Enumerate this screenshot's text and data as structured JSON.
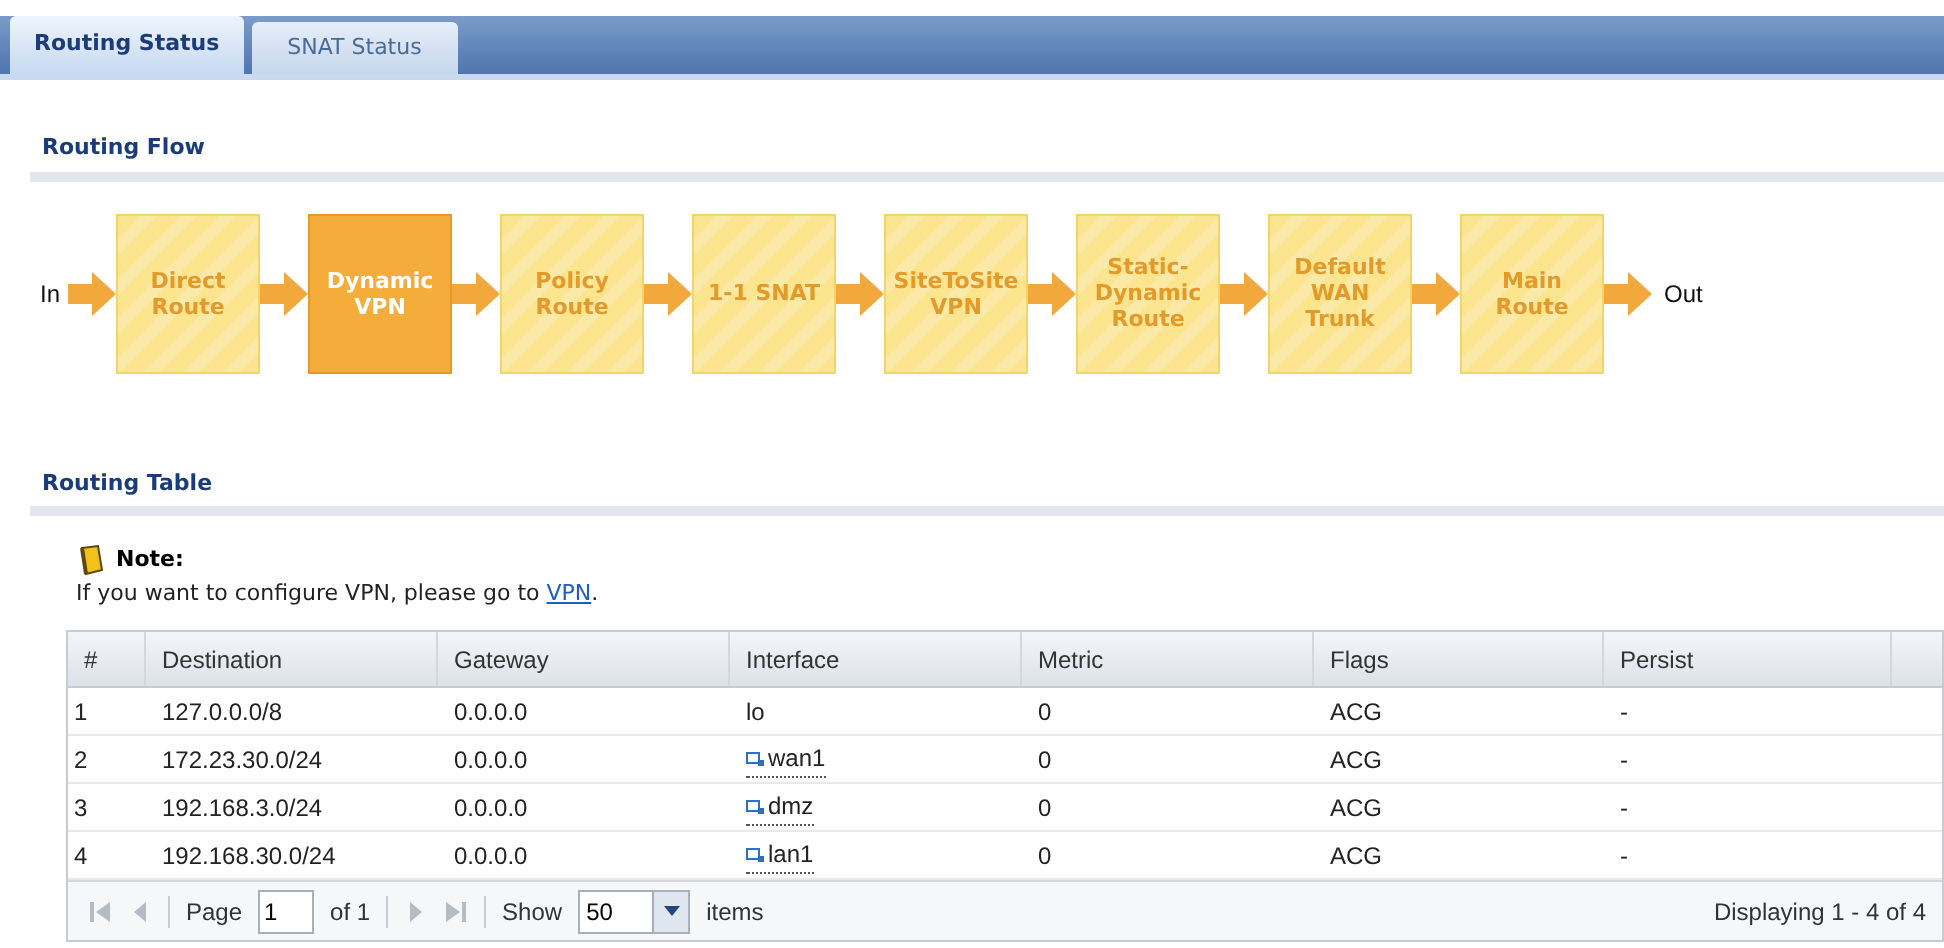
{
  "tabs": [
    {
      "label": "Routing Status",
      "selected": true
    },
    {
      "label": "SNAT Status",
      "selected": false
    }
  ],
  "routing_flow": {
    "title": "Routing Flow",
    "start": "In",
    "end": "Out",
    "steps": [
      {
        "label": "Direct Route",
        "selected": false
      },
      {
        "label": "Dynamic VPN",
        "selected": true
      },
      {
        "label": "Policy Route",
        "selected": false
      },
      {
        "label": "1-1 SNAT",
        "selected": false
      },
      {
        "label": "SiteToSite VPN",
        "selected": false
      },
      {
        "label": "Static-Dynamic Route",
        "selected": false
      },
      {
        "label": "Default WAN Trunk",
        "selected": false
      },
      {
        "label": "Main Route",
        "selected": false
      }
    ]
  },
  "routing_table": {
    "title": "Routing Table",
    "note_title": "Note:",
    "note_text": "If you want to configure VPN, please go to ",
    "note_link": "VPN",
    "note_end": ".",
    "columns": [
      "#",
      "Destination",
      "Gateway",
      "Interface",
      "Metric",
      "Flags",
      "Persist"
    ],
    "rows": [
      {
        "cells": [
          "1",
          "127.0.0.0/8",
          "0.0.0.0",
          "lo",
          "0",
          "ACG",
          "-"
        ],
        "interface_linked": false
      },
      {
        "cells": [
          "2",
          "172.23.30.0/24",
          "0.0.0.0",
          "wan1",
          "0",
          "ACG",
          "-"
        ],
        "interface_linked": true
      },
      {
        "cells": [
          "3",
          "192.168.3.0/24",
          "0.0.0.0",
          "dmz",
          "0",
          "ACG",
          "-"
        ],
        "interface_linked": true
      },
      {
        "cells": [
          "4",
          "192.168.30.0/24",
          "0.0.0.0",
          "lan1",
          "0",
          "ACG",
          "-"
        ],
        "interface_linked": true
      }
    ],
    "pager": {
      "page_label": "Page",
      "page": "1",
      "of": "of 1",
      "show_label": "Show",
      "show": "50",
      "items_label": "items",
      "display": "Displaying 1 - 4 of 4"
    }
  }
}
